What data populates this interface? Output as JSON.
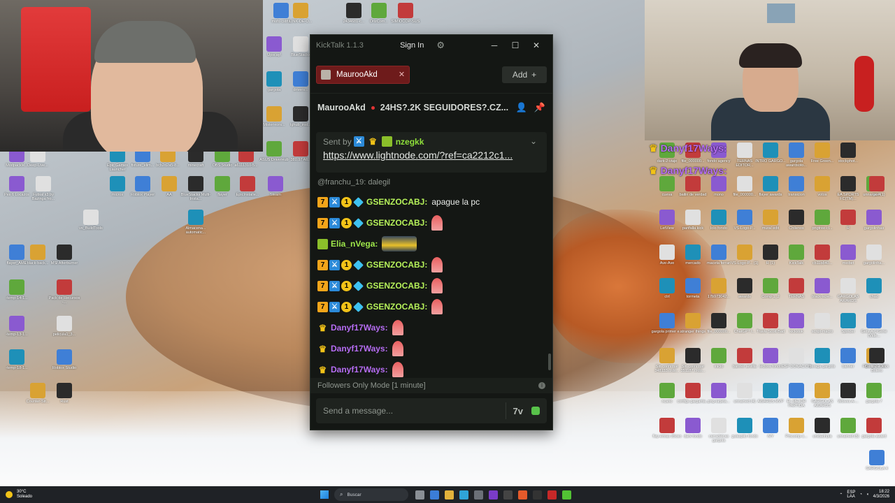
{
  "desktop": {
    "icons_top": [
      "mofo cstrts",
      "LINK-DE-O...",
      "2434681-c...",
      "DrizCom...",
      "SIMIOCOP-SUS"
    ],
    "icons_left": [
      [
        "Upscayl",
        "BlueStacks"
      ],
      [
        "gargola",
        "drivers..."
      ],
      [
        "MisterHors...",
        "lghub_inst..."
      ],
      [
        "ASUS DriverHub",
        "380.97 All..."
      ],
      [
        "ModpackM...",
        "Deep-Live...",
        "Epic Games Launcher",
        "fixture_elim...",
        "bcb2d2a5-8...",
        "minecraft",
        "OBS Studio",
        "a6111310-5..."
      ],
      [
        "Pes 6 Locazos",
        "Futsal x3 by Bazinga fro...",
        "micros",
        "Roblox Player",
        "AA",
        "BlueStacks Multi-Insta...",
        "flayer",
        "EpicInstalle...",
        "Steam"
      ],
      [
        "vs_BuildTools",
        "Almacena... automatic..."
      ],
      [
        "flayer_AME",
        "black-back...",
        "MSI Afterburner"
      ],
      [
        "-temp-14-1...",
        "Pack de Recursos -..."
      ],
      [
        "-temp-13-1...",
        "pelicula1_3..."
      ],
      [
        "-temp-18-1...",
        "Roblox Studio"
      ],
      [
        "Counter-Str...",
        "Rust"
      ]
    ],
    "icons_right": [
      [
        "dark-2-viaje",
        "file_000000...",
        "fondo agency",
        "TERNAS EDITOR...",
        "INTRO GARGO...",
        "gargola awardsoto...",
        "Free Green...",
        "stockphot..."
      ],
      [
        "cueva",
        "bailin de verdad",
        "mono",
        "file_000000...",
        "flayer awards",
        "transicion",
        "votos",
        "EA SPORTS FC(TM)...",
        "unnamed (1)",
        "gc-4"
      ],
      [
        "LetView",
        "panfalla kick",
        "lolo fondo",
        "VS-Logo-P...",
        "mural edit",
        "Chilenos",
        "pngtree-cl...",
        "R",
        "gargolinhas"
      ],
      [
        "Ave-Ave",
        "mercado",
        "maceta ferrari",
        "VS-Logo-P... (1)",
        "R (1)",
        "KickTalk",
        "cb11b840...",
        "meibet",
        "gargolinha..."
      ],
      [
        "ctrl",
        "tormeta",
        "17b973042...",
        "awards",
        "Comp 1_2",
        "TERNAS",
        "black-scre...",
        "GARGOLAS AWARDS",
        "chad"
      ],
      [
        "gargola primer e...",
        "stranger things",
        "file_000000...",
        "ChatGPT I...",
        "Travis Scott Bad",
        "kickstok",
        "script-macro",
        "Spinder",
        "Gets-A-0 Gerie (Vide..."
      ],
      [
        "Sin confirmar 348133.crdo...",
        "Sin confirmar 351187.crdo...",
        "inicio",
        "banner sevilla",
        "lectora fondo",
        "ESP DONACION",
        "bsraga gargols",
        "banner",
        "FBR-DRUGA",
        "Curtil-2-e Kick Bolero"
      ],
      [
        "ncario",
        "configs garganta...",
        "png-tarjeta...",
        "unnamed (4)",
        "AWARDS MVP",
        "EL MEJOR PARTIDA",
        "GARGOLAS AWARDS",
        "Wolves A-...",
        "gargola 7"
      ],
      [
        "flay-ertras 35oso",
        "dark fondo",
        "carradelcas gargola",
        "guiaspito fondo",
        "IVY",
        "Pmcomp-1...",
        "unidadhpia",
        "unnamed (5)",
        "gargola award"
      ],
      [
        "Sin confirm 338672...",
        "czerro g",
        "IMG_6..."
      ],
      [
        "GARGOLA 4"
      ]
    ]
  },
  "overlay": {
    "names": [
      "Danyf17Ways:",
      "Danyf17Ways:"
    ]
  },
  "kicktalk": {
    "app_title": "KickTalk 1.1.3",
    "sign_in_label": "Sign In",
    "tabs": [
      {
        "label": "MaurooAkd"
      }
    ],
    "add_label": "Add",
    "header": {
      "channel": "MaurooAkd",
      "stream_title": "24HS?.2K SEGUIDORES?.CZ..."
    },
    "pinned": {
      "sent_by_label": "Sent by",
      "sender": "nzegkk",
      "link": "https://www.lightnode.com/?ref=ca2212c1..."
    },
    "reply_to": "@franchu_19: dalegil",
    "messages": [
      {
        "user": "GSENZOCABJ:",
        "text": "apague la pc",
        "color": "green"
      },
      {
        "user": "GSENZOCABJ:",
        "text": "",
        "color": "green"
      },
      {
        "user": "Elia_nVega:",
        "text": "",
        "color": "lime"
      },
      {
        "user": "GSENZOCABJ:",
        "text": "",
        "color": "green"
      },
      {
        "user": "GSENZOCABJ:",
        "text": "",
        "color": "green"
      },
      {
        "user": "GSENZOCABJ:",
        "text": "",
        "color": "green"
      },
      {
        "user": "Danyf17Ways:",
        "text": "",
        "color": "purple"
      },
      {
        "user": "Danyf17Ways:",
        "text": "",
        "color": "purple"
      },
      {
        "user": "Danyf17Ways:",
        "text": "",
        "color": "purple"
      }
    ],
    "mode_label": "Followers Only Mode [1 minute]",
    "input_placeholder": "Send a message..."
  },
  "taskbar": {
    "weather_temp": "30°C",
    "weather_desc": "Soleado",
    "search_placeholder": "Buscar",
    "lang": "ESP",
    "lang2": "LAA",
    "time": "18:22",
    "date": "4/3/2026"
  }
}
